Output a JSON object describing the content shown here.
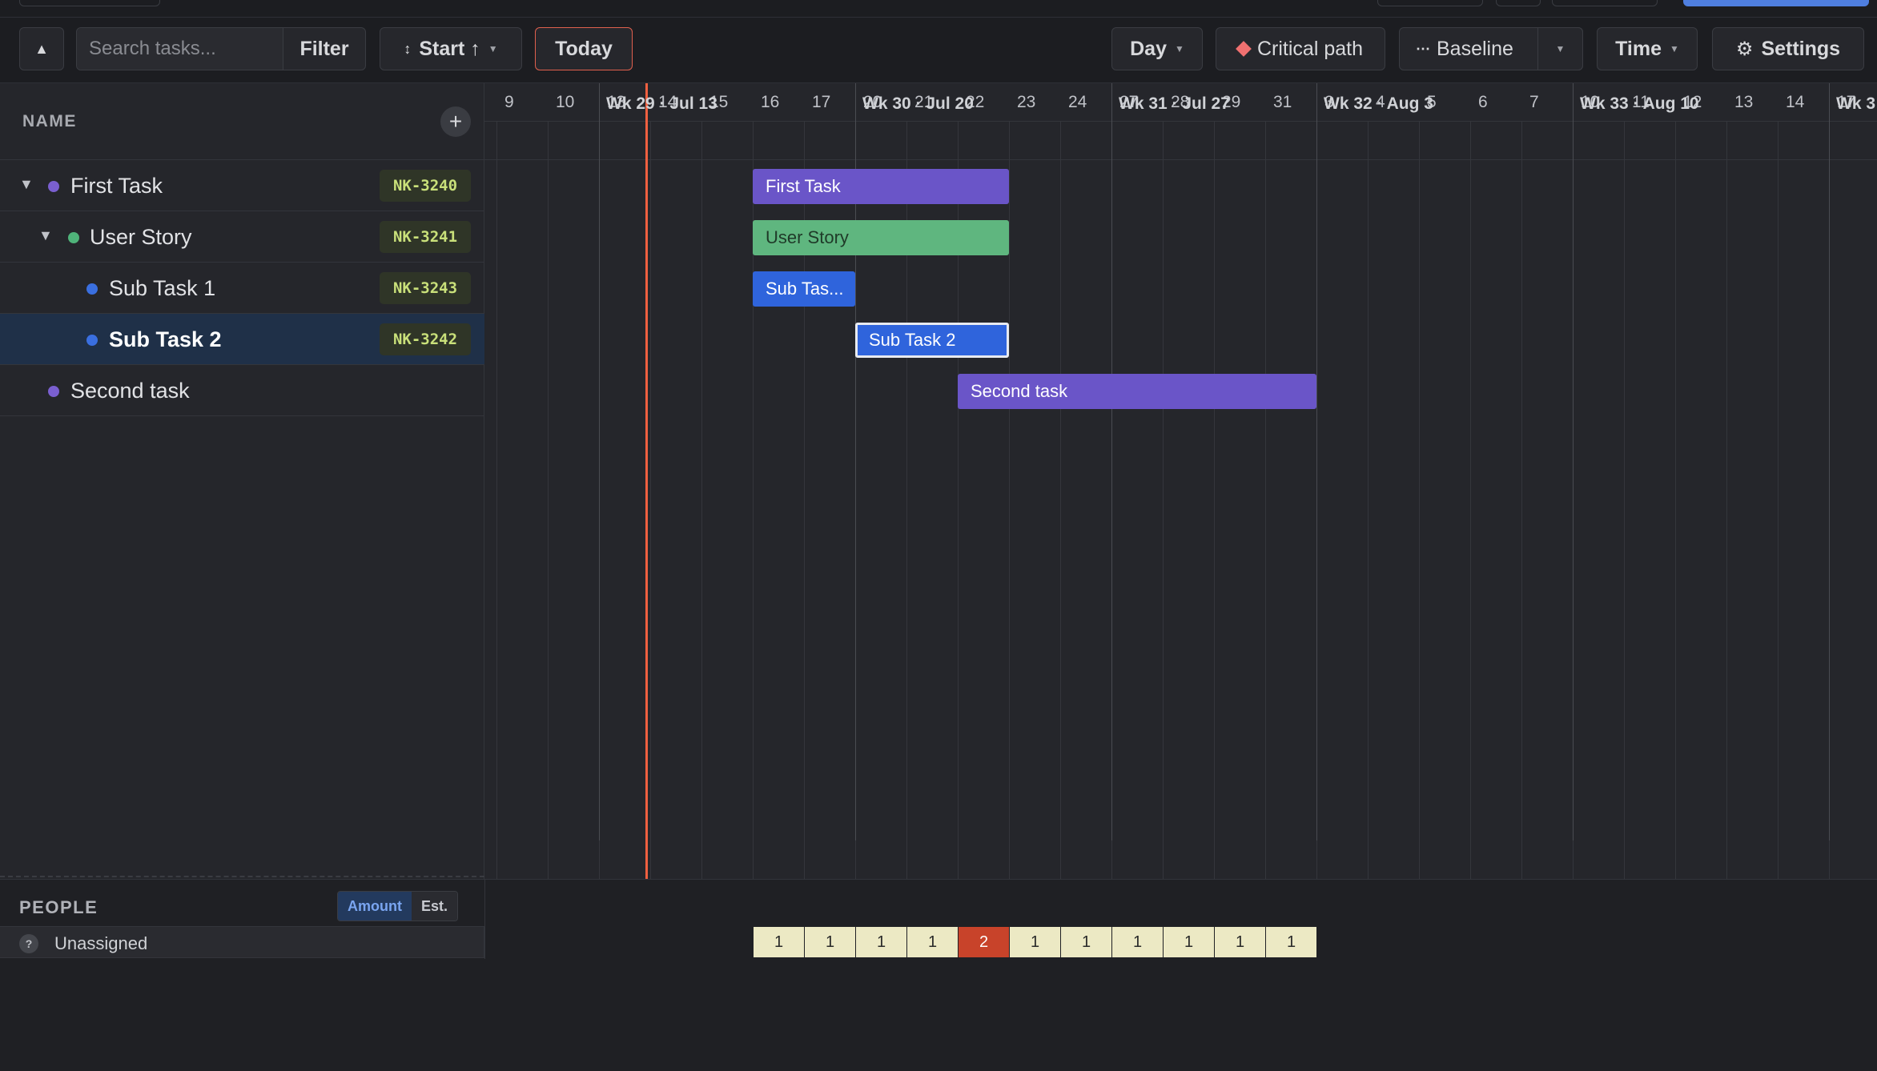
{
  "toolbar": {
    "collapse_icon": "triangle-up-icon",
    "search_placeholder": "Search tasks...",
    "filter_label": "Filter",
    "sort_label": "Start ↑",
    "today_label": "Today",
    "zoom_label": "Day",
    "critical_path_label": "Critical path",
    "baseline_label": "Baseline",
    "time_label": "Time",
    "settings_label": "Settings"
  },
  "tree": {
    "header": "NAME",
    "add_label": "+",
    "rows": [
      {
        "name": "First Task",
        "key": "NK-3240",
        "color": "#7a5fd0",
        "expanded": true
      },
      {
        "name": "User Story",
        "key": "NK-3241",
        "color": "#4fb37a",
        "expanded": true
      },
      {
        "name": "Sub Task 1",
        "key": "NK-3243",
        "color": "#3a6fe0"
      },
      {
        "name": "Sub Task 2",
        "key": "NK-3242",
        "color": "#3a6fe0",
        "selected": true
      },
      {
        "name": "Second task",
        "color": "#7a5fd0"
      }
    ]
  },
  "timeline": {
    "weeks": [
      "Wk 29 · Jul 13",
      "Wk 30 · Jul 20",
      "Wk 31 · Jul 27",
      "Wk 32 · Aug 3",
      "Wk 33 · Aug 10",
      "Wk 3"
    ],
    "days": [
      "9",
      "10",
      "13",
      "14",
      "15",
      "16",
      "17",
      "20",
      "21",
      "22",
      "23",
      "24",
      "27",
      "28",
      "29",
      "31",
      "3",
      "4",
      "5",
      "6",
      "7",
      "10",
      "11",
      "12",
      "13",
      "14",
      "17"
    ],
    "bars": [
      {
        "label": "First Task",
        "color": "#6a55c8"
      },
      {
        "label": "User Story",
        "color": "#5fb67f"
      },
      {
        "label": "Sub Tas...",
        "color": "#2f64dc"
      },
      {
        "label": "Sub Task 2",
        "color": "#2f64dc"
      },
      {
        "label": "Second task",
        "color": "#6a55c8"
      }
    ]
  },
  "people": {
    "header": "PEOPLE",
    "toggle_on": "Amount",
    "toggle_off": "Est.",
    "rows": [
      {
        "name": "Unassigned",
        "avatar": "?",
        "cells": [
          "1",
          "1",
          "1",
          "1",
          "2",
          "1",
          "1",
          "1",
          "1",
          "1",
          "1"
        ]
      }
    ]
  }
}
